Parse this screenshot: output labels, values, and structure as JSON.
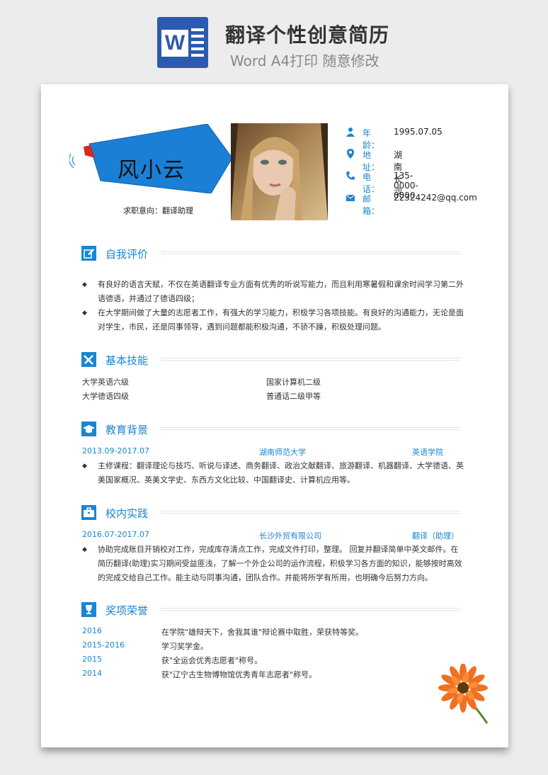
{
  "banner": {
    "logo_letter": "W",
    "title": "翻译个性创意简历",
    "subtitle": "Word A4打印 随意修改"
  },
  "profile": {
    "name": "风小云",
    "job_intent": "求职意向：翻译助理",
    "info": [
      {
        "icon": "person-icon",
        "label": "年龄：",
        "value": "1995.07.05"
      },
      {
        "icon": "location-pin-icon",
        "label": "地址：",
        "value": "湖南 长沙"
      },
      {
        "icon": "phone-icon",
        "label": "电话：",
        "value": "135-0000-0000"
      },
      {
        "icon": "envelope-icon",
        "label": "邮箱：",
        "value": "22324242@qq.com"
      }
    ]
  },
  "self_eval": {
    "title": "自我评价",
    "items": [
      "有良好的语言天赋，不仅在英语翻译专业方面有优秀的听说写能力，而且利用寒暑假和课余时间学习第二外语德语，并通过了德语四级；",
      "在大学期间做了大量的志愿者工作，有强大的学习能力，积极学习各项技能。有良好的沟通能力，无论是面对学生，市民，还是同事领导，遇到问题都能积极沟通，不骄不躁，积极处理问题。"
    ]
  },
  "skills": {
    "title": "基本技能",
    "items": [
      "大学英语六级",
      "国家计算机二级",
      "大学德语四级",
      "普通话二级甲等"
    ]
  },
  "education": {
    "title": "教育背景",
    "period": "2013.09-2017.07",
    "school": "湖南师范大学",
    "major": "英语学院",
    "detail": "主修课程：翻译理论与技巧、听说与译述、商务翻译、政治文献翻译、旅游翻译、机器翻译、大学德语、英美国家概况、英美文学史、东西方文化比较、中国翻译史、计算机应用等。"
  },
  "practice": {
    "title": "校内实践",
    "period": "2016.07-2017.07",
    "company": "长沙外贸有限公司",
    "role": "翻译（助理）",
    "detail": "协助完成账目开销校对工作，完成库存清点工作，完成文件打印，整理。 回复并翻译简单中英文邮件。在简历翻译(助理)实习期间受益匪浅，了解一个外企公司的运作流程，积极学习各方面的知识，能够按时高效的完成交给自己工作。能主动与同事沟通，团队合作。并能将所学有所用，也明确今后努力方向。"
  },
  "awards": {
    "title": "奖项荣誉",
    "items": [
      {
        "year": "2016",
        "text": "在学院\"雄辩天下，舍我其谁\"辩论赛中取胜，荣获特等奖。"
      },
      {
        "year": "2015-2016",
        "text": "学习奖学金。"
      },
      {
        "year": "2015",
        "text": "获\"全运会优秀志愿者\"称号。"
      },
      {
        "year": "2014",
        "text": "获\"辽宁古生物博物馆优秀青年志愿者\"称号。"
      }
    ]
  },
  "colors": {
    "accent": "#1a86d1",
    "banner_blue": "#1565c8",
    "word_blue": "#2b5bb0"
  }
}
